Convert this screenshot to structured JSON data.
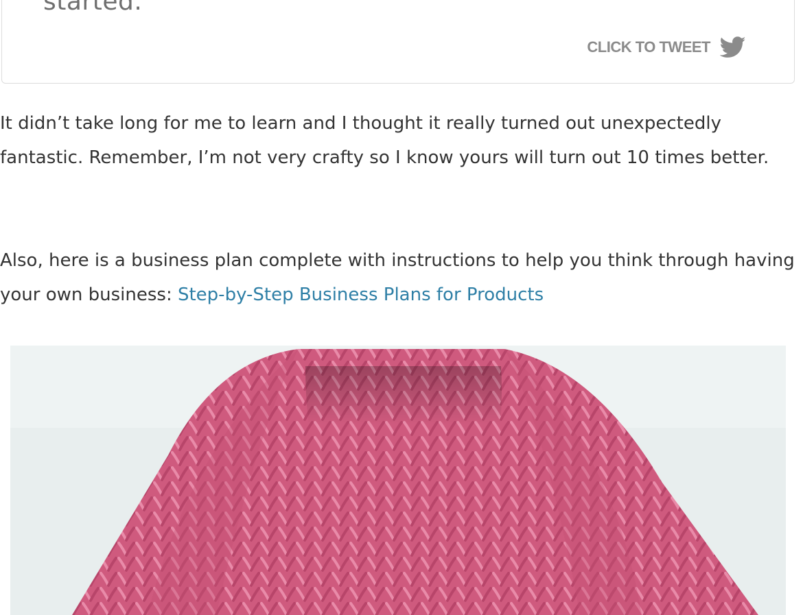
{
  "tweet_box": {
    "quote_text": "started.",
    "cta_label": "CLICK TO TWEET",
    "cta_icon": "twitter-bird-icon",
    "icon_color": "#8b8b8b"
  },
  "article": {
    "paragraph_1": "It didn’t take long for me to learn and I thought it really turned out unexpectedly fantastic. Remember, I’m not very crafty so I know yours will turn out 10 times better.",
    "paragraph_2_prefix": "Also, here is a business plan complete with instructions to help you think through having your own business: ",
    "paragraph_2_link": "Step-by-Step Business Plans for Products",
    "link_color": "#2e7fa6",
    "text_color": "#333333"
  },
  "image": {
    "subject": "pink-knit-cowl-photo",
    "main_color": "#cf5a7e"
  }
}
